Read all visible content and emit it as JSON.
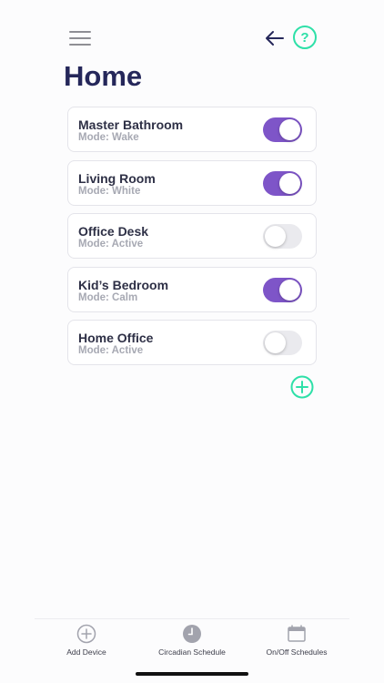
{
  "header": {
    "menu_icon": "hamburger-menu-icon",
    "back_icon": "arrow-left-icon",
    "help_label": "?"
  },
  "page": {
    "title": "Home"
  },
  "devices": [
    {
      "name": "Master Bathroom",
      "mode": "Mode: Wake",
      "on": true
    },
    {
      "name": "Living Room",
      "mode": "Mode: White",
      "on": true
    },
    {
      "name": "Office Desk",
      "mode": "Mode: Active",
      "on": false
    },
    {
      "name": "Kid’s Bedroom",
      "mode": "Mode: Calm",
      "on": true
    },
    {
      "name": "Home Office",
      "mode": "Mode: Active",
      "on": false
    }
  ],
  "add_button_icon": "plus-circle-icon",
  "tabbar": {
    "tabs": [
      {
        "label": "Add Device",
        "icon": "plus-circle-icon"
      },
      {
        "label": "Circadian Schedule",
        "icon": "clock-icon"
      },
      {
        "label": "On/Off Schedules",
        "icon": "calendar-icon"
      }
    ]
  },
  "colors": {
    "accent_purple": "#7e55c8",
    "accent_green": "#2ee0a8",
    "title_navy": "#25275a",
    "toggle_off": "#eaeaee"
  }
}
